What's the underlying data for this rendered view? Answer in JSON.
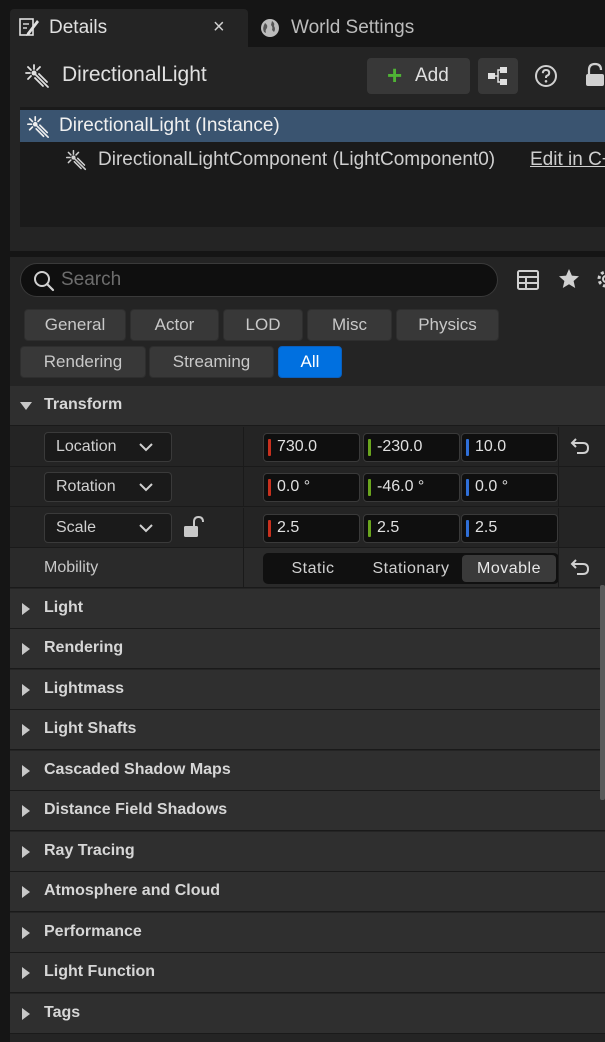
{
  "tabs": {
    "details": {
      "label": "Details",
      "close": "×"
    },
    "world_settings": {
      "label": "World Settings"
    }
  },
  "actor": {
    "name": "DirectionalLight",
    "add_label": "Add",
    "add_plus": "+"
  },
  "components": [
    {
      "label": "DirectionalLight (Instance)"
    },
    {
      "label": "DirectionalLightComponent (LightComponent0)",
      "action": "Edit in C++"
    }
  ],
  "search": {
    "placeholder": "Search",
    "value": ""
  },
  "filters": {
    "row1": [
      "General",
      "Actor",
      "LOD",
      "Misc",
      "Physics"
    ],
    "row2": [
      "Rendering",
      "Streaming",
      "All"
    ],
    "active": "All"
  },
  "transform": {
    "header": "Transform",
    "location": {
      "label": "Location",
      "x": "730.0",
      "y": "-230.0",
      "z": "10.0"
    },
    "rotation": {
      "label": "Rotation",
      "x": "0.0 °",
      "y": "-46.0 °",
      "z": "0.0 °"
    },
    "scale": {
      "label": "Scale",
      "x": "2.5",
      "y": "2.5",
      "z": "2.5"
    },
    "mobility": {
      "label": "Mobility",
      "options": [
        "Static",
        "Stationary",
        "Movable"
      ],
      "selected": "Movable"
    }
  },
  "categories": [
    "Light",
    "Rendering",
    "Lightmass",
    "Light Shafts",
    "Cascaded Shadow Maps",
    "Distance Field Shadows",
    "Ray Tracing",
    "Atmosphere and Cloud",
    "Performance",
    "Light Function",
    "Tags"
  ],
  "colors": {
    "x_axis": "#c8301e",
    "y_axis": "#6aa51e",
    "z_axis": "#2f6fd8",
    "accent": "#0070e0",
    "selection": "#3a5470"
  }
}
